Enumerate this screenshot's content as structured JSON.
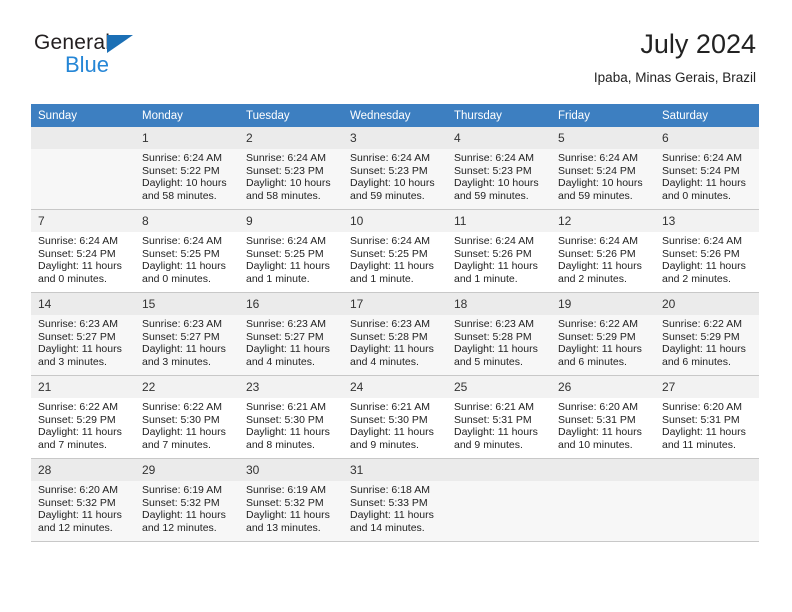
{
  "brand": {
    "name_part1": "General",
    "name_part2": "Blue",
    "logo_icon": "triangle-flag-icon"
  },
  "header": {
    "title": "July 2024",
    "subtitle": "Ipaba, Minas Gerais, Brazil"
  },
  "calendar": {
    "weekday_headers": [
      "Sunday",
      "Monday",
      "Tuesday",
      "Wednesday",
      "Thursday",
      "Friday",
      "Saturday"
    ],
    "header_bg": "#3d7fc1",
    "header_text_color": "#ffffff",
    "weeks": [
      [
        {
          "day": "",
          "sunrise": "",
          "sunset": "",
          "daylight": "",
          "daylight2": ""
        },
        {
          "day": "1",
          "sunrise": "Sunrise: 6:24 AM",
          "sunset": "Sunset: 5:22 PM",
          "daylight": "Daylight: 10 hours",
          "daylight2": "and 58 minutes."
        },
        {
          "day": "2",
          "sunrise": "Sunrise: 6:24 AM",
          "sunset": "Sunset: 5:23 PM",
          "daylight": "Daylight: 10 hours",
          "daylight2": "and 58 minutes."
        },
        {
          "day": "3",
          "sunrise": "Sunrise: 6:24 AM",
          "sunset": "Sunset: 5:23 PM",
          "daylight": "Daylight: 10 hours",
          "daylight2": "and 59 minutes."
        },
        {
          "day": "4",
          "sunrise": "Sunrise: 6:24 AM",
          "sunset": "Sunset: 5:23 PM",
          "daylight": "Daylight: 10 hours",
          "daylight2": "and 59 minutes."
        },
        {
          "day": "5",
          "sunrise": "Sunrise: 6:24 AM",
          "sunset": "Sunset: 5:24 PM",
          "daylight": "Daylight: 10 hours",
          "daylight2": "and 59 minutes."
        },
        {
          "day": "6",
          "sunrise": "Sunrise: 6:24 AM",
          "sunset": "Sunset: 5:24 PM",
          "daylight": "Daylight: 11 hours",
          "daylight2": "and 0 minutes."
        }
      ],
      [
        {
          "day": "7",
          "sunrise": "Sunrise: 6:24 AM",
          "sunset": "Sunset: 5:24 PM",
          "daylight": "Daylight: 11 hours",
          "daylight2": "and 0 minutes."
        },
        {
          "day": "8",
          "sunrise": "Sunrise: 6:24 AM",
          "sunset": "Sunset: 5:25 PM",
          "daylight": "Daylight: 11 hours",
          "daylight2": "and 0 minutes."
        },
        {
          "day": "9",
          "sunrise": "Sunrise: 6:24 AM",
          "sunset": "Sunset: 5:25 PM",
          "daylight": "Daylight: 11 hours",
          "daylight2": "and 1 minute."
        },
        {
          "day": "10",
          "sunrise": "Sunrise: 6:24 AM",
          "sunset": "Sunset: 5:25 PM",
          "daylight": "Daylight: 11 hours",
          "daylight2": "and 1 minute."
        },
        {
          "day": "11",
          "sunrise": "Sunrise: 6:24 AM",
          "sunset": "Sunset: 5:26 PM",
          "daylight": "Daylight: 11 hours",
          "daylight2": "and 1 minute."
        },
        {
          "day": "12",
          "sunrise": "Sunrise: 6:24 AM",
          "sunset": "Sunset: 5:26 PM",
          "daylight": "Daylight: 11 hours",
          "daylight2": "and 2 minutes."
        },
        {
          "day": "13",
          "sunrise": "Sunrise: 6:24 AM",
          "sunset": "Sunset: 5:26 PM",
          "daylight": "Daylight: 11 hours",
          "daylight2": "and 2 minutes."
        }
      ],
      [
        {
          "day": "14",
          "sunrise": "Sunrise: 6:23 AM",
          "sunset": "Sunset: 5:27 PM",
          "daylight": "Daylight: 11 hours",
          "daylight2": "and 3 minutes."
        },
        {
          "day": "15",
          "sunrise": "Sunrise: 6:23 AM",
          "sunset": "Sunset: 5:27 PM",
          "daylight": "Daylight: 11 hours",
          "daylight2": "and 3 minutes."
        },
        {
          "day": "16",
          "sunrise": "Sunrise: 6:23 AM",
          "sunset": "Sunset: 5:27 PM",
          "daylight": "Daylight: 11 hours",
          "daylight2": "and 4 minutes."
        },
        {
          "day": "17",
          "sunrise": "Sunrise: 6:23 AM",
          "sunset": "Sunset: 5:28 PM",
          "daylight": "Daylight: 11 hours",
          "daylight2": "and 4 minutes."
        },
        {
          "day": "18",
          "sunrise": "Sunrise: 6:23 AM",
          "sunset": "Sunset: 5:28 PM",
          "daylight": "Daylight: 11 hours",
          "daylight2": "and 5 minutes."
        },
        {
          "day": "19",
          "sunrise": "Sunrise: 6:22 AM",
          "sunset": "Sunset: 5:29 PM",
          "daylight": "Daylight: 11 hours",
          "daylight2": "and 6 minutes."
        },
        {
          "day": "20",
          "sunrise": "Sunrise: 6:22 AM",
          "sunset": "Sunset: 5:29 PM",
          "daylight": "Daylight: 11 hours",
          "daylight2": "and 6 minutes."
        }
      ],
      [
        {
          "day": "21",
          "sunrise": "Sunrise: 6:22 AM",
          "sunset": "Sunset: 5:29 PM",
          "daylight": "Daylight: 11 hours",
          "daylight2": "and 7 minutes."
        },
        {
          "day": "22",
          "sunrise": "Sunrise: 6:22 AM",
          "sunset": "Sunset: 5:30 PM",
          "daylight": "Daylight: 11 hours",
          "daylight2": "and 7 minutes."
        },
        {
          "day": "23",
          "sunrise": "Sunrise: 6:21 AM",
          "sunset": "Sunset: 5:30 PM",
          "daylight": "Daylight: 11 hours",
          "daylight2": "and 8 minutes."
        },
        {
          "day": "24",
          "sunrise": "Sunrise: 6:21 AM",
          "sunset": "Sunset: 5:30 PM",
          "daylight": "Daylight: 11 hours",
          "daylight2": "and 9 minutes."
        },
        {
          "day": "25",
          "sunrise": "Sunrise: 6:21 AM",
          "sunset": "Sunset: 5:31 PM",
          "daylight": "Daylight: 11 hours",
          "daylight2": "and 9 minutes."
        },
        {
          "day": "26",
          "sunrise": "Sunrise: 6:20 AM",
          "sunset": "Sunset: 5:31 PM",
          "daylight": "Daylight: 11 hours",
          "daylight2": "and 10 minutes."
        },
        {
          "day": "27",
          "sunrise": "Sunrise: 6:20 AM",
          "sunset": "Sunset: 5:31 PM",
          "daylight": "Daylight: 11 hours",
          "daylight2": "and 11 minutes."
        }
      ],
      [
        {
          "day": "28",
          "sunrise": "Sunrise: 6:20 AM",
          "sunset": "Sunset: 5:32 PM",
          "daylight": "Daylight: 11 hours",
          "daylight2": "and 12 minutes."
        },
        {
          "day": "29",
          "sunrise": "Sunrise: 6:19 AM",
          "sunset": "Sunset: 5:32 PM",
          "daylight": "Daylight: 11 hours",
          "daylight2": "and 12 minutes."
        },
        {
          "day": "30",
          "sunrise": "Sunrise: 6:19 AM",
          "sunset": "Sunset: 5:32 PM",
          "daylight": "Daylight: 11 hours",
          "daylight2": "and 13 minutes."
        },
        {
          "day": "31",
          "sunrise": "Sunrise: 6:18 AM",
          "sunset": "Sunset: 5:33 PM",
          "daylight": "Daylight: 11 hours",
          "daylight2": "and 14 minutes."
        },
        {
          "day": "",
          "sunrise": "",
          "sunset": "",
          "daylight": "",
          "daylight2": ""
        },
        {
          "day": "",
          "sunrise": "",
          "sunset": "",
          "daylight": "",
          "daylight2": ""
        },
        {
          "day": "",
          "sunrise": "",
          "sunset": "",
          "daylight": "",
          "daylight2": ""
        }
      ]
    ]
  }
}
